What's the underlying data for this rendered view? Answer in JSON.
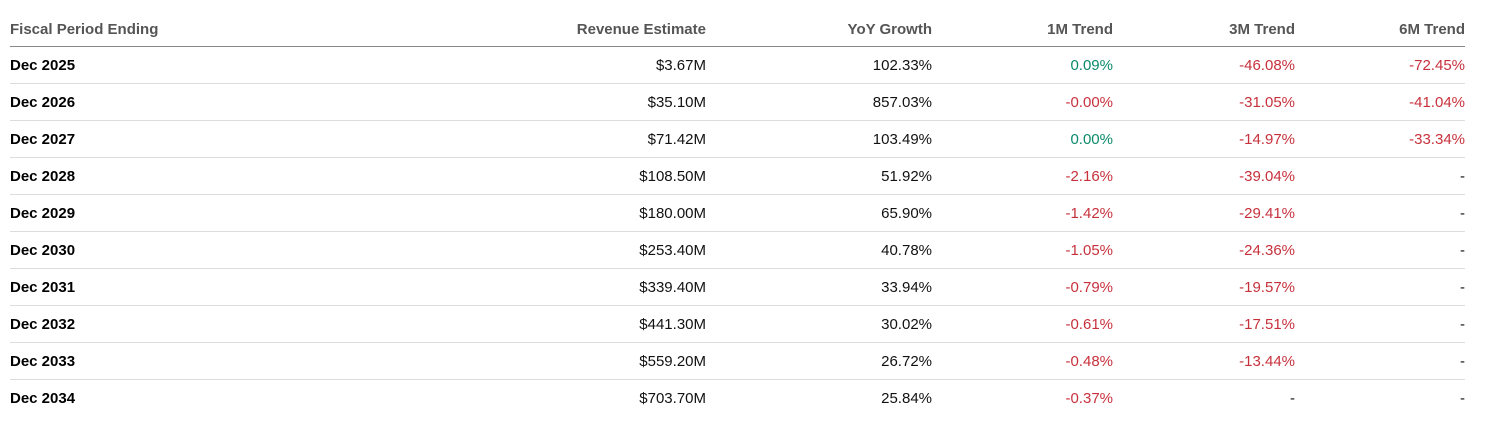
{
  "colors": {
    "positive": "#0b8a6b",
    "negative": "#c7313c"
  },
  "headers": [
    "Fiscal Period Ending",
    "Revenue Estimate",
    "YoY Growth",
    "1M Trend",
    "3M Trend",
    "6M Trend"
  ],
  "rows": [
    [
      "Dec 2025",
      "$3.67M",
      "102.33%",
      "0.09%",
      "-46.08%",
      "-72.45%"
    ],
    [
      "Dec 2026",
      "$35.10M",
      "857.03%",
      "-0.00%",
      "-31.05%",
      "-41.04%"
    ],
    [
      "Dec 2027",
      "$71.42M",
      "103.49%",
      "0.00%",
      "-14.97%",
      "-33.34%"
    ],
    [
      "Dec 2028",
      "$108.50M",
      "51.92%",
      "-2.16%",
      "-39.04%",
      "-"
    ],
    [
      "Dec 2029",
      "$180.00M",
      "65.90%",
      "-1.42%",
      "-29.41%",
      "-"
    ],
    [
      "Dec 2030",
      "$253.40M",
      "40.78%",
      "-1.05%",
      "-24.36%",
      "-"
    ],
    [
      "Dec 2031",
      "$339.40M",
      "33.94%",
      "-0.79%",
      "-19.57%",
      "-"
    ],
    [
      "Dec 2032",
      "$441.30M",
      "30.02%",
      "-0.61%",
      "-17.51%",
      "-"
    ],
    [
      "Dec 2033",
      "$559.20M",
      "26.72%",
      "-0.48%",
      "-13.44%",
      "-"
    ],
    [
      "Dec 2034",
      "$703.70M",
      "25.84%",
      "-0.37%",
      "-",
      "-"
    ]
  ]
}
